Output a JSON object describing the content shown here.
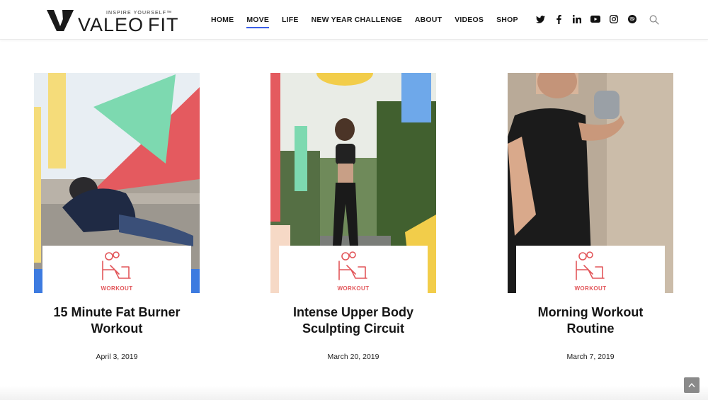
{
  "brand": {
    "tagline": "INSPIRE YOURSELF™",
    "name_part1": "VALEO",
    "name_part2": "FIT"
  },
  "nav": {
    "items": [
      {
        "label": "HOME"
      },
      {
        "label": "MOVE",
        "active": true
      },
      {
        "label": "LIFE"
      },
      {
        "label": "NEW YEAR CHALLENGE"
      },
      {
        "label": "ABOUT"
      },
      {
        "label": "VIDEOS"
      },
      {
        "label": "SHOP"
      }
    ],
    "active_color": "#3b5ee8"
  },
  "social": [
    "twitter-icon",
    "facebook-icon",
    "linkedin-icon",
    "youtube-icon",
    "instagram-icon",
    "spotify-icon"
  ],
  "colors": {
    "category": "#e2565a",
    "shape_green": "#7dd9b0",
    "shape_red": "#e45a5f",
    "shape_yellow": "#f5dc7a",
    "shape_blue": "#3d7be0",
    "shape_sky": "#6ea8ea",
    "shape_peach": "#f6d9c6"
  },
  "posts": [
    {
      "category": "WORKOUT",
      "title_line1": "15 Minute Fat Burner",
      "title_line2": "Workout",
      "date": "April 3, 2019"
    },
    {
      "category": "WORKOUT",
      "title_line1": "Intense Upper Body",
      "title_line2": "Sculpting Circuit",
      "date": "March 20, 2019"
    },
    {
      "category": "WORKOUT",
      "title_line1": "Morning Workout",
      "title_line2": "Routine",
      "date": "March 7, 2019"
    }
  ]
}
